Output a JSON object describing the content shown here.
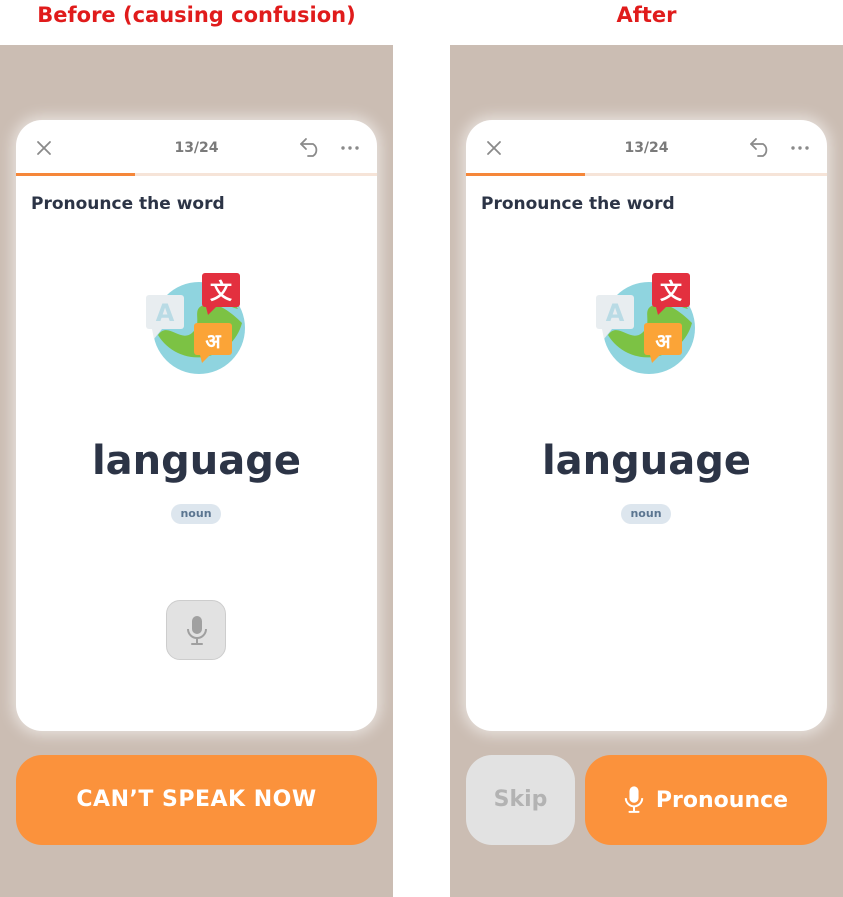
{
  "captions": {
    "before": "Before (causing confusion)",
    "after": "After"
  },
  "colors": {
    "caption_red": "#e01b1b",
    "panel_bg": "#cbbdb3",
    "accent_orange": "#fb923c",
    "progress_orange": "#f5873a",
    "text_dark": "#2c3446",
    "disabled_gray": "#e2e2e2"
  },
  "lesson": {
    "counter": "13/24",
    "progress_fraction": 0.33,
    "prompt": "Pronounce the word",
    "word": "language",
    "part_of_speech": "noun",
    "icons": {
      "close": "close-icon",
      "undo": "undo-icon",
      "more": "more-icon",
      "illustration": "globe-translate-icon",
      "mic": "microphone-icon"
    }
  },
  "before": {
    "primary_button": "CAN’T SPEAK NOW"
  },
  "after": {
    "skip_button": "Skip",
    "pronounce_button": "Pronounce"
  }
}
